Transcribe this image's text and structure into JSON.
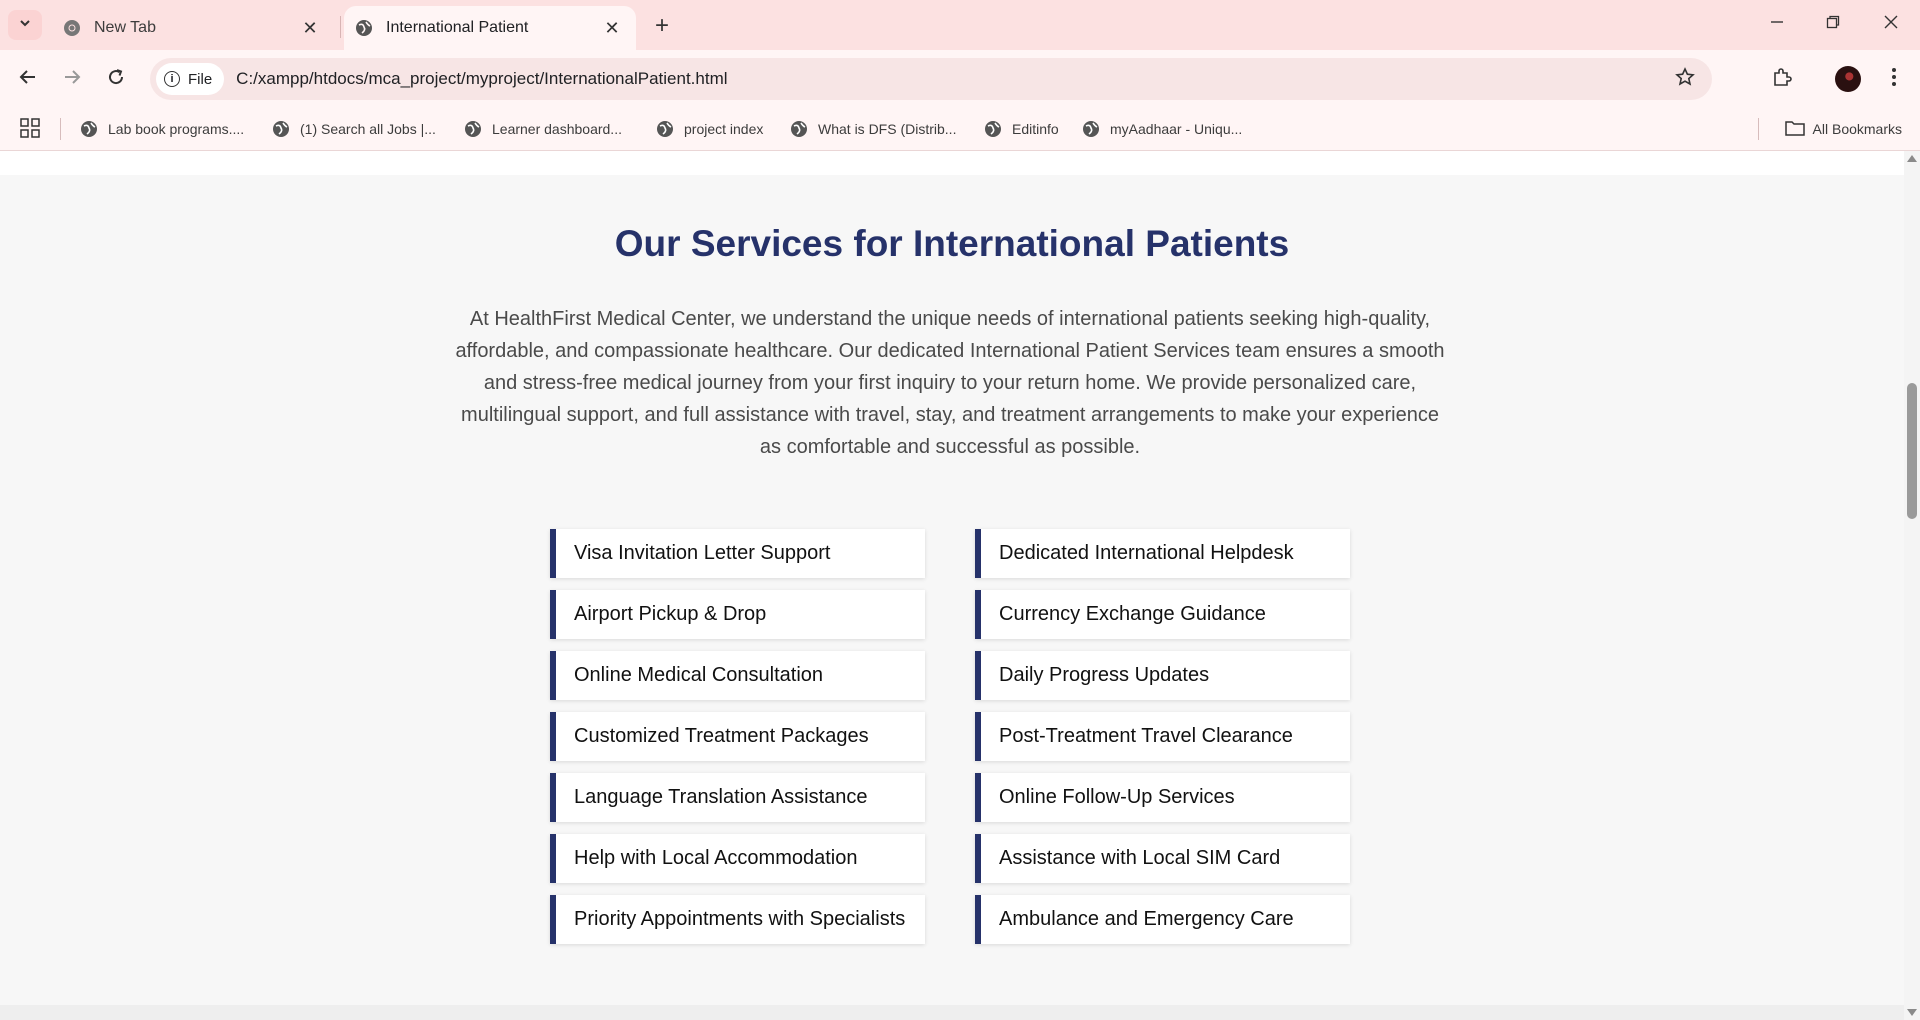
{
  "browser": {
    "tabs": [
      {
        "title": "New Tab",
        "active": false,
        "icon": "chrome-icon"
      },
      {
        "title": "International Patient",
        "active": true,
        "icon": "globe-icon"
      }
    ],
    "address": {
      "scheme_chip": "File",
      "url": "C:/xampp/htdocs/mca_project/myproject/InternationalPatient.html"
    },
    "bookmarks": [
      {
        "label": "Lab book programs...."
      },
      {
        "label": "(1) Search all Jobs |..."
      },
      {
        "label": "Learner dashboard..."
      },
      {
        "label": "project index"
      },
      {
        "label": "What is DFS (Distrib..."
      },
      {
        "label": "Editinfo"
      },
      {
        "label": "myAadhaar - Uniqu..."
      }
    ],
    "all_bookmarks": "All Bookmarks",
    "accent_color": "#fce1e1"
  },
  "page": {
    "heading": "Our Services for International Patients",
    "intro": "At HealthFirst Medical Center, we understand the unique needs of international patients seeking high-quality, affordable, and compassionate healthcare. Our dedicated International Patient Services team ensures a smooth and stress-free medical journey from your first inquiry to your return home. We provide personalized care, multilingual support, and full assistance with travel, stay, and treatment arrangements to make your experience as comfortable and successful as possible.",
    "services": [
      "Visa Invitation Letter Support",
      "Dedicated International Helpdesk",
      "Airport Pickup & Drop",
      "Currency Exchange Guidance",
      "Online Medical Consultation",
      "Daily Progress Updates",
      "Customized Treatment Packages",
      "Post-Treatment Travel Clearance",
      "Language Translation Assistance",
      "Online Follow-Up Services",
      "Help with Local Accommodation",
      "Assistance with Local SIM Card",
      "Priority Appointments with Specialists",
      "Ambulance and Emergency Care"
    ],
    "brand_color": "#26326a"
  }
}
